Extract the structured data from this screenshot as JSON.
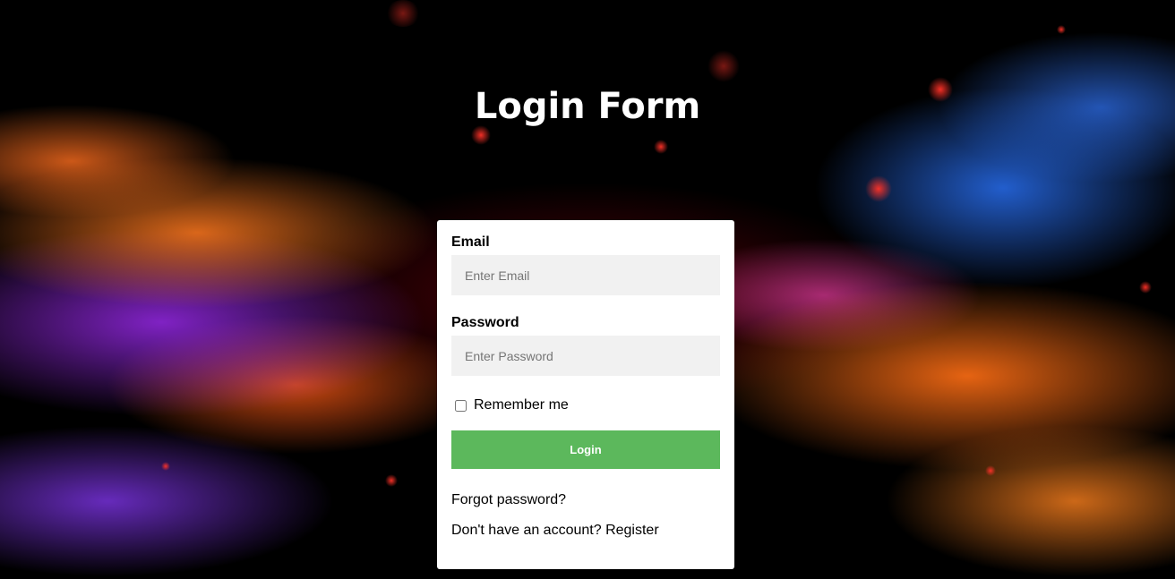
{
  "page": {
    "title": "Login Form"
  },
  "form": {
    "email_label": "Email",
    "email_placeholder": "Enter Email",
    "email_value": "",
    "password_label": "Password",
    "password_placeholder": "Enter Password",
    "password_value": "",
    "remember_label": "Remember me",
    "remember_checked": false,
    "login_label": "Login",
    "forgot_label": "Forgot password?",
    "register_prompt": "Don't have an account?",
    "register_label": "Register"
  },
  "colors": {
    "button": "#5cb85c",
    "input_bg": "#f1f1f1",
    "card_bg": "#ffffff",
    "title": "#ffffff"
  }
}
